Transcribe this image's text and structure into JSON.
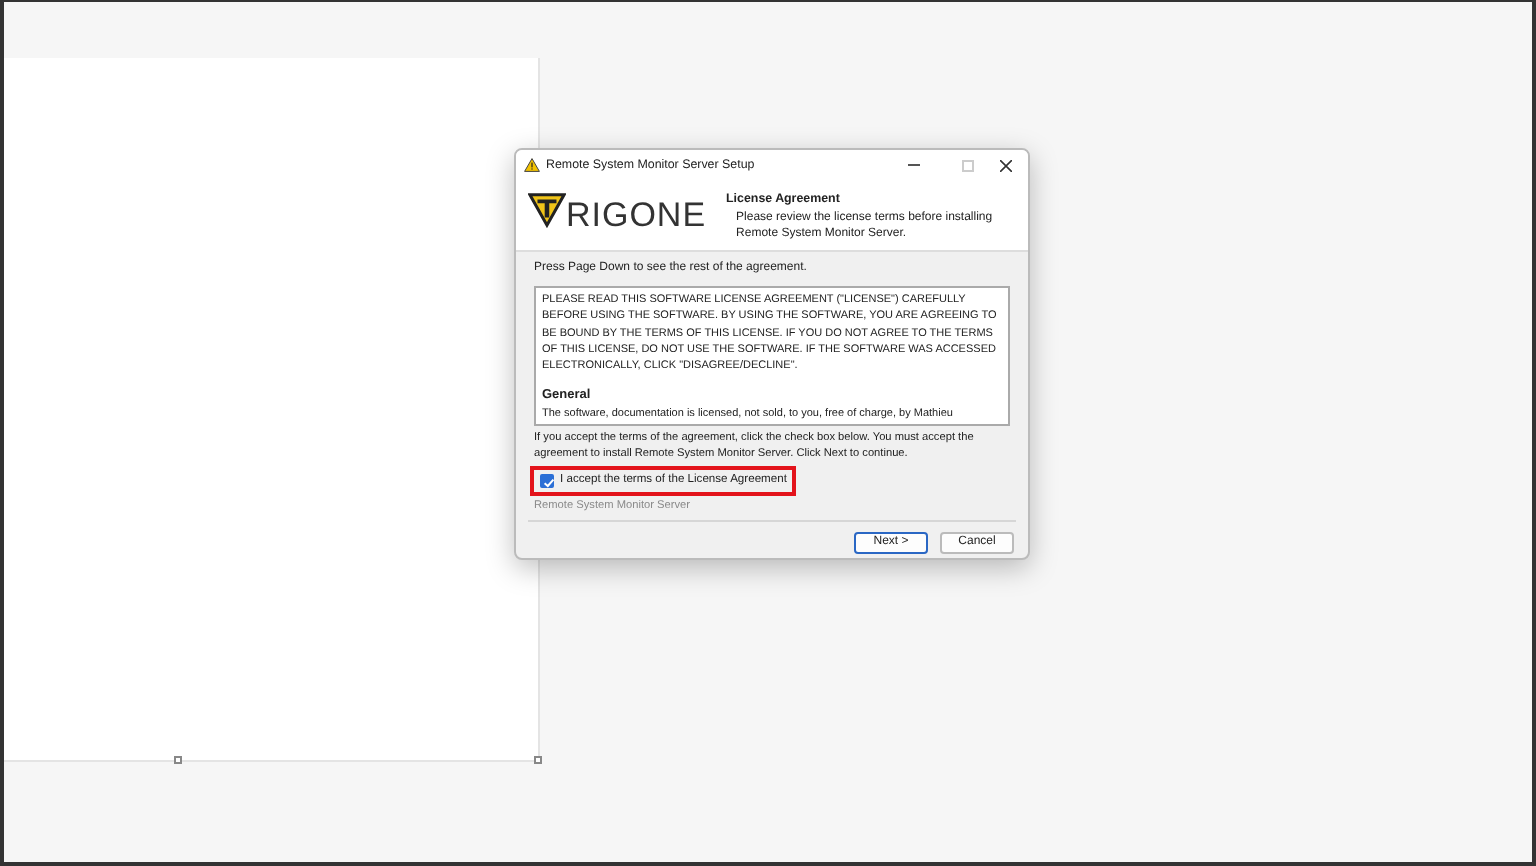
{
  "dialog": {
    "title": "Remote System Monitor Server Setup",
    "logo_text": "RIGONE",
    "heading": "License Agreement",
    "subheading": "Please review the license terms before installing Remote System Monitor Server.",
    "instruction": "Press Page Down to see the rest of the agreement.",
    "license_paragraphs": [
      {
        "kind": "text",
        "text": "PLEASE READ THIS SOFTWARE LICENSE AGREEMENT (\"LICENSE\") CAREFULLY BEFORE USING THE SOFTWARE.  BY USING THE  SOFTWARE, YOU ARE AGREEING TO BE BOUND BY THE TERMS OF THIS LICENSE. IF YOU DO NOT AGREE TO THE TERMS OF THIS LICENSE, DO NOT USE THE SOFTWARE. IF THE SOFTWARE WAS ACCESSED ELECTRONICALLY, CLICK \"DISAGREE/DECLINE\"."
      },
      {
        "kind": "heading",
        "text": "General"
      },
      {
        "kind": "text",
        "text": "The software, documentation is licensed, not sold, to you, free of charge, by Mathieu"
      }
    ],
    "note": "If you accept the terms of the agreement, click the check box below. You must accept the agreement to install Remote System Monitor Server. Click Next to continue.",
    "accept": {
      "label": "I accept the terms of the License Agreement",
      "checked": true,
      "highlighted": true
    },
    "branding": "Remote System Monitor Server",
    "buttons": [
      {
        "label": "Next >",
        "default": true
      },
      {
        "label": "Cancel",
        "default": false
      }
    ]
  }
}
